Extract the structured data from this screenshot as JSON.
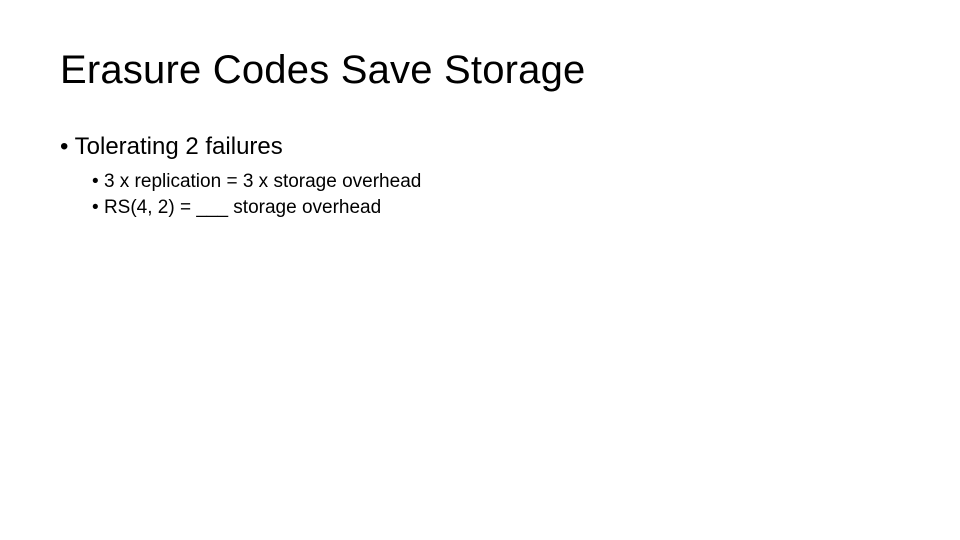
{
  "title": "Erasure Codes Save Storage",
  "bullets": {
    "item1": {
      "text": "Tolerating 2 failures",
      "sub": {
        "a": "3 x replication = 3 x storage overhead",
        "b": "RS(4, 2) = ___ storage overhead"
      }
    }
  }
}
